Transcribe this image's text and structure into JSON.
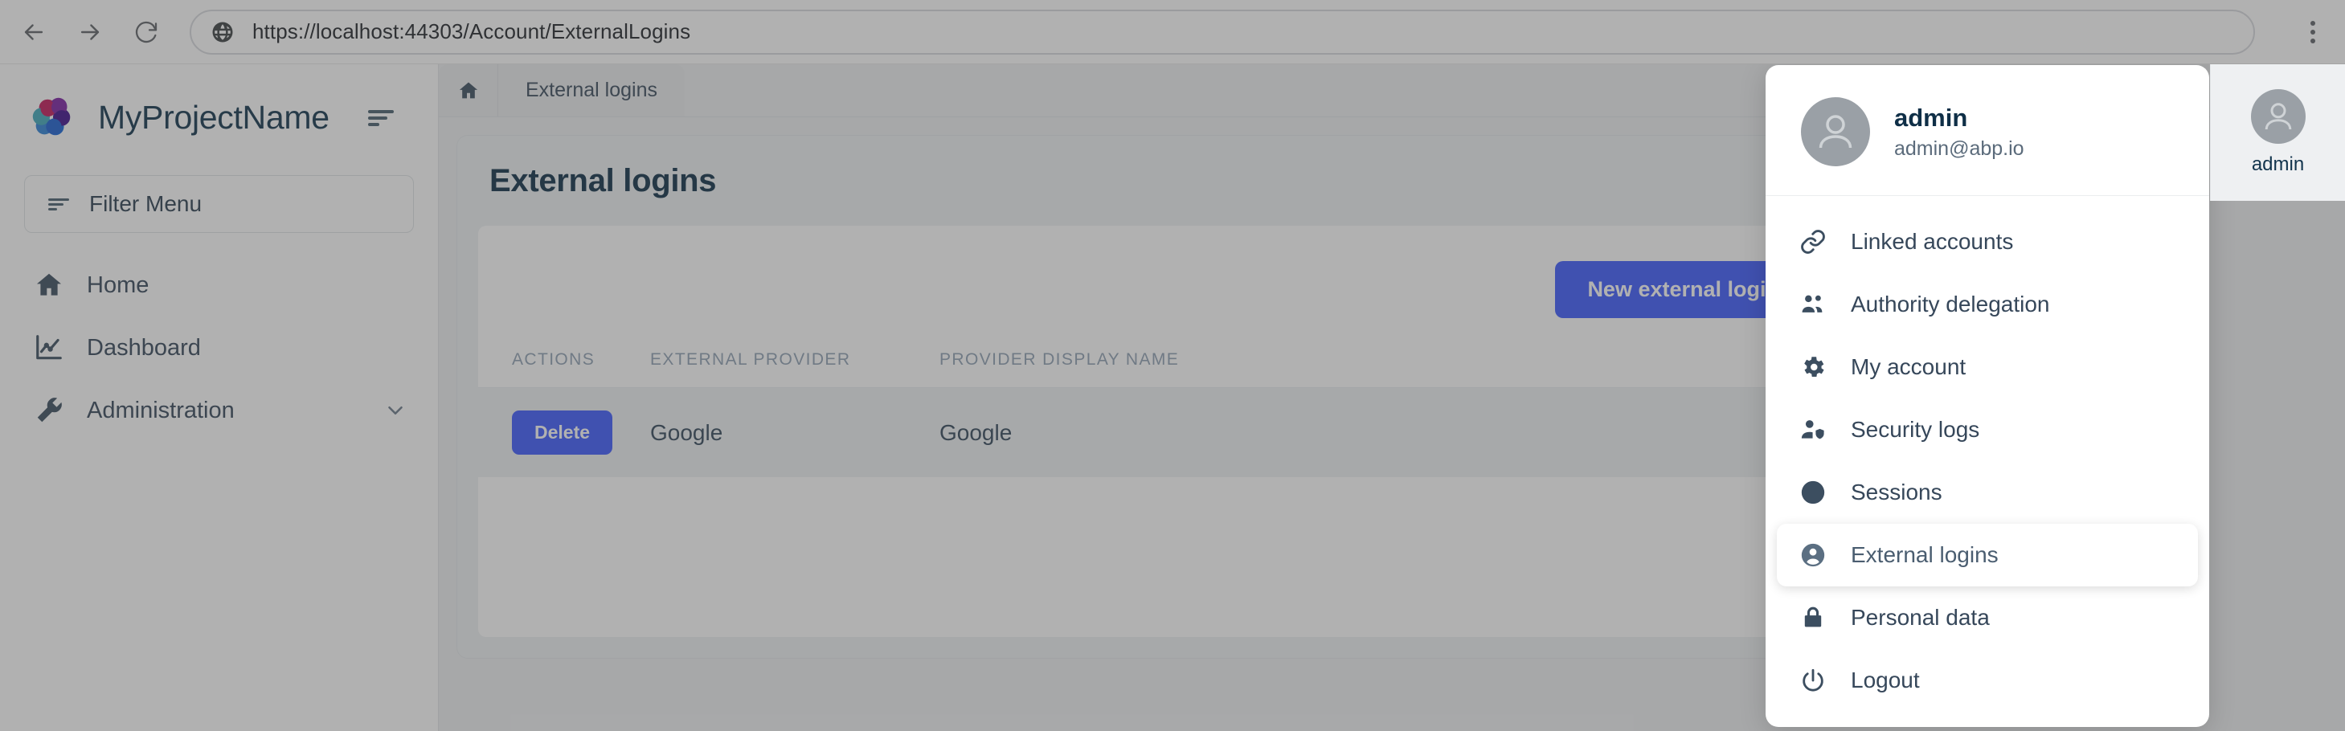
{
  "browser": {
    "url": "https://localhost:44303/Account/ExternalLogins",
    "back_label": "Back",
    "forward_label": "Forward",
    "reload_label": "Reload",
    "menu_label": "Customize and control",
    "site_icon": "globe-icon"
  },
  "sidebar": {
    "brand_name": "MyProjectName",
    "logo_icon": "abp-logo-icon",
    "collapse_icon": "menu-collapse-icon",
    "filter": {
      "label": "Filter Menu",
      "icon": "filter-icon"
    },
    "items": [
      {
        "label": "Home",
        "icon": "home-icon",
        "has_chevron": false
      },
      {
        "label": "Dashboard",
        "icon": "chart-line-icon",
        "has_chevron": false
      },
      {
        "label": "Administration",
        "icon": "wrench-icon",
        "has_chevron": true
      }
    ]
  },
  "breadcrumb": {
    "home_icon": "home-icon",
    "items": [
      "External logins"
    ]
  },
  "main": {
    "card_title": "External logins",
    "new_button_label": "New external login",
    "table": {
      "columns": [
        "ACTIONS",
        "EXTERNAL PROVIDER",
        "PROVIDER DISPLAY NAME"
      ],
      "rows": [
        {
          "action_label": "Delete",
          "external_provider": "Google",
          "provider_display_name": "Google"
        }
      ]
    }
  },
  "user_dropdown": {
    "avatar_icon": "user-avatar-icon",
    "username": "admin",
    "email": "admin@abp.io",
    "items": [
      {
        "label": "Linked accounts",
        "icon": "link-icon",
        "active": false
      },
      {
        "label": "Authority delegation",
        "icon": "people-icon",
        "active": false
      },
      {
        "label": "My account",
        "icon": "gear-icon",
        "active": false
      },
      {
        "label": "Security logs",
        "icon": "person-shield-icon",
        "active": false
      },
      {
        "label": "Sessions",
        "icon": "clock-icon",
        "active": false
      },
      {
        "label": "External logins",
        "icon": "person-circle-icon",
        "active": true
      },
      {
        "label": "Personal data",
        "icon": "lock-icon",
        "active": false
      },
      {
        "label": "Logout",
        "icon": "power-icon",
        "active": false
      }
    ]
  },
  "topbar_user": {
    "name": "admin",
    "avatar_icon": "user-avatar-icon"
  },
  "colors": {
    "primary_button": "#3d5afe",
    "heading_text": "#0f2f47",
    "body_text": "#36475a",
    "table_header_text": "#8fa1b3",
    "panel_bg": "#eef1f3"
  }
}
